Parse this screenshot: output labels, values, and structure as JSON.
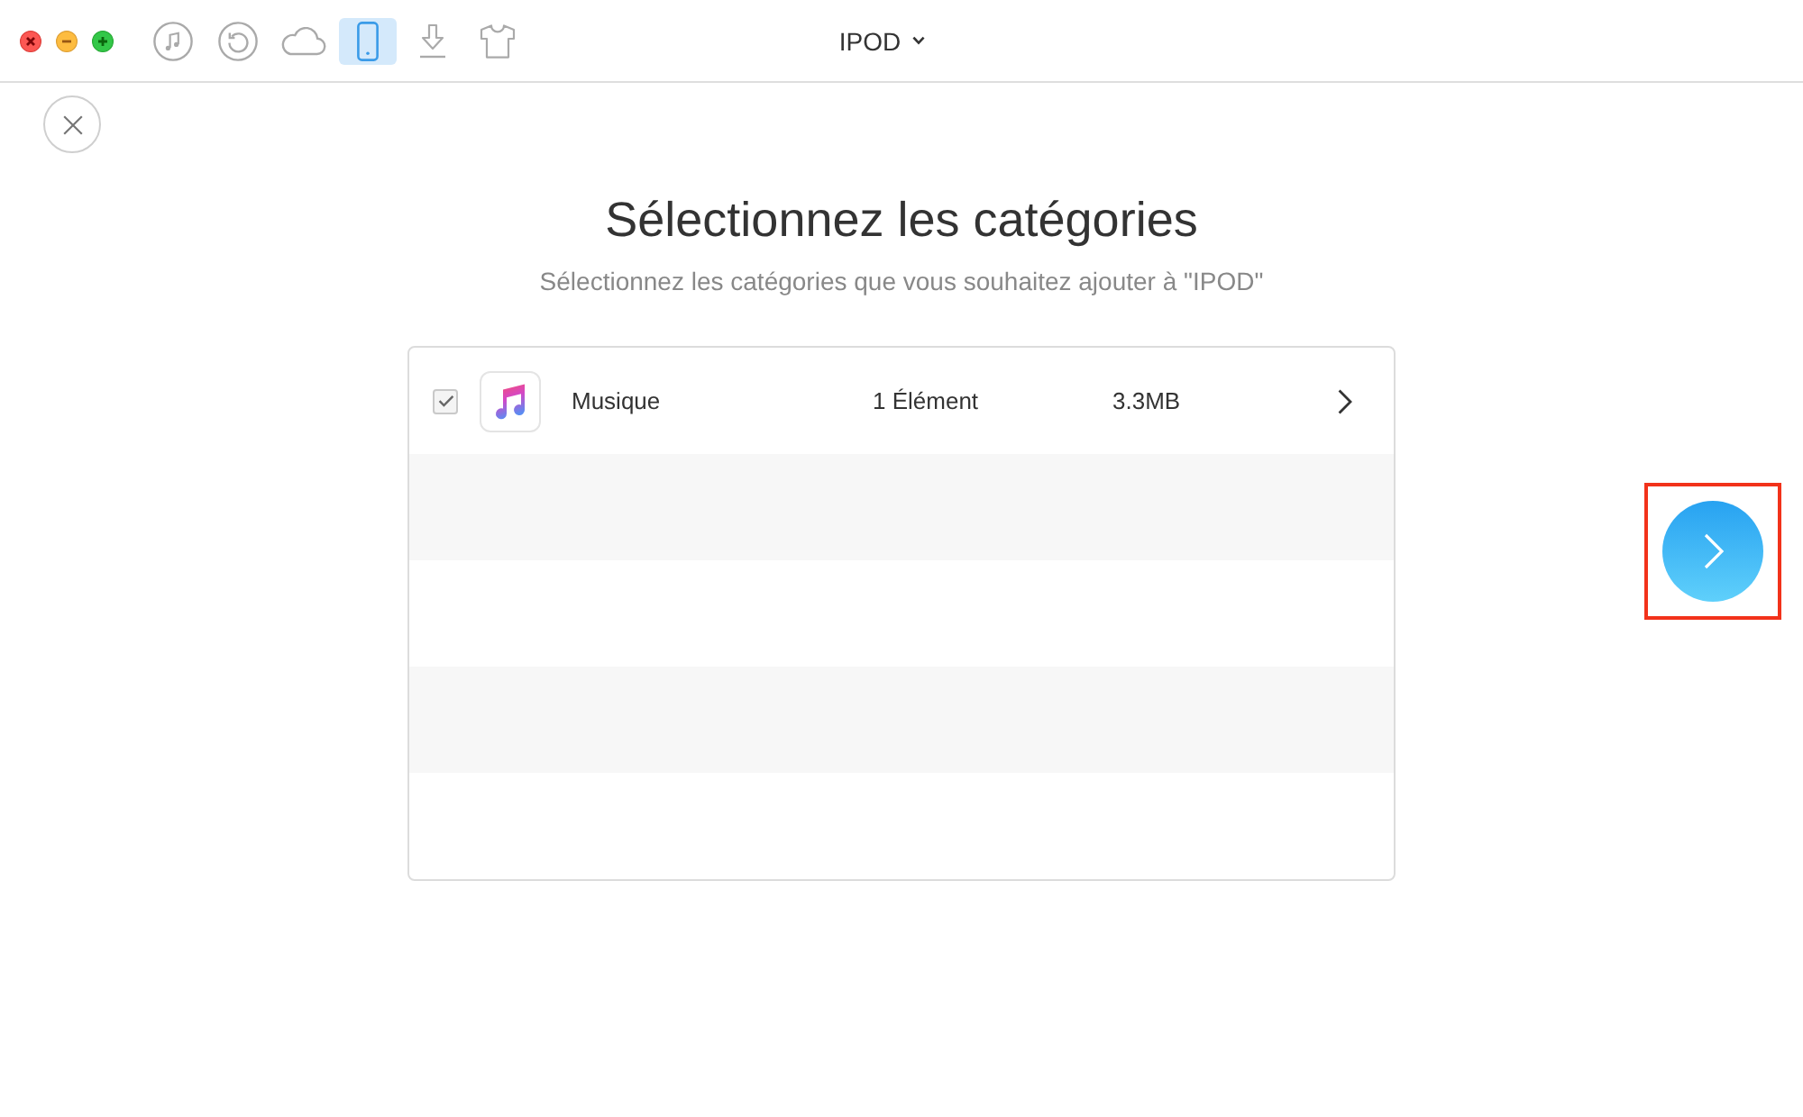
{
  "window": {
    "title": "IPOD"
  },
  "toolbar": {
    "items": [
      {
        "kind": "music",
        "selected": false
      },
      {
        "kind": "restore",
        "selected": false
      },
      {
        "kind": "cloud",
        "selected": false
      },
      {
        "kind": "device",
        "selected": true
      },
      {
        "kind": "download",
        "selected": false
      },
      {
        "kind": "shirt",
        "selected": false
      }
    ]
  },
  "heading": "Sélectionnez les catégories",
  "subtitle": "Sélectionnez les catégories que vous souhaitez ajouter à \"IPOD\"",
  "categories": [
    {
      "name": "Musique",
      "checked": true,
      "count": "1 Élément",
      "size": "3.3MB"
    }
  ],
  "next_button": {
    "highlighted": true
  }
}
